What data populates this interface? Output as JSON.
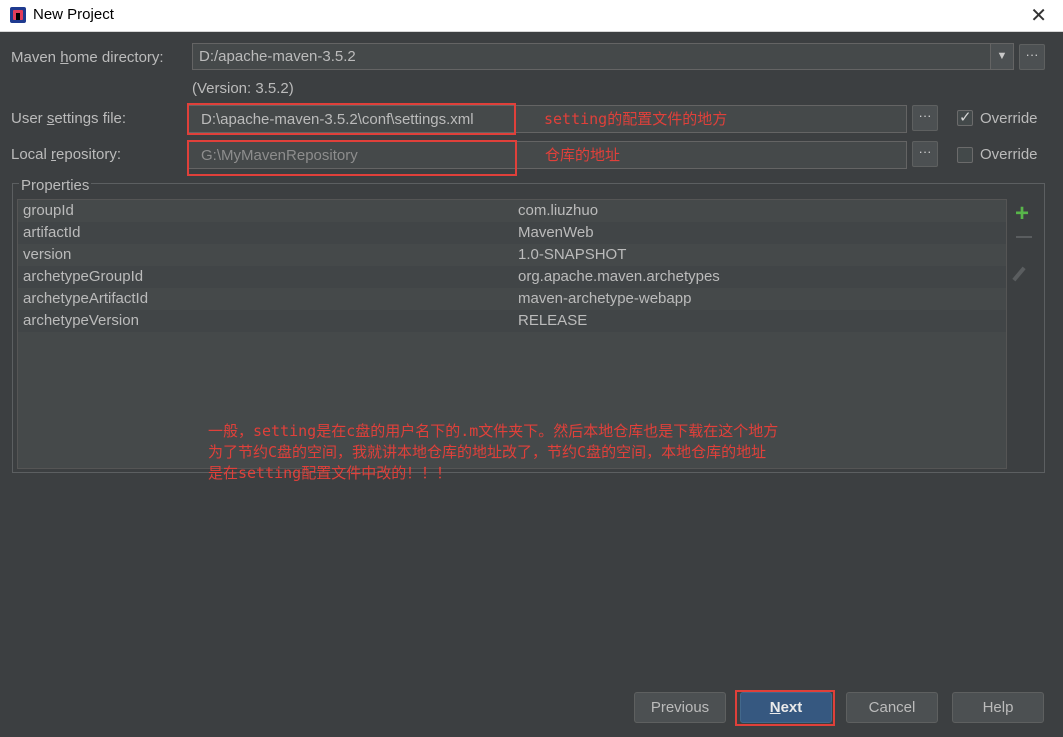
{
  "window": {
    "title": "New Project",
    "close_glyph": "✕"
  },
  "maven_home": {
    "label_pre": "Maven ",
    "label_u": "h",
    "label_post": "ome directory:",
    "value": "D:/apache-maven-3.5.2",
    "version_text": "(Version: 3.5.2)",
    "dropdown_glyph": "▼",
    "browse": "···"
  },
  "user_settings": {
    "label_pre": "User ",
    "label_u": "s",
    "label_post": "ettings file:",
    "value": "D:\\apache-maven-3.5.2\\conf\\settings.xml",
    "browse": "···",
    "override_label": "Override",
    "override_checked": true
  },
  "local_repo": {
    "label_pre": "Local ",
    "label_u": "r",
    "label_post": "epository:",
    "value": "G:\\MyMavenRepository",
    "browse": "···",
    "override_label": "Override",
    "override_checked": false
  },
  "properties": {
    "title": "Properties",
    "rows": [
      {
        "key": "groupId",
        "value": "com.liuzhuo"
      },
      {
        "key": "artifactId",
        "value": "MavenWeb"
      },
      {
        "key": "version",
        "value": "1.0-SNAPSHOT"
      },
      {
        "key": "archetypeGroupId",
        "value": "org.apache.maven.archetypes"
      },
      {
        "key": "archetypeArtifactId",
        "value": "maven-archetype-webapp"
      },
      {
        "key": "archetypeVersion",
        "value": "RELEASE"
      }
    ],
    "add_glyph": "+"
  },
  "annotations": {
    "settings_note": "setting的配置文件的地方",
    "repo_note": "仓库的地址",
    "line1": "一般，setting是在c盘的用户名下的.m文件夹下。然后本地仓库也是下载在这个地方",
    "line2": "为了节约C盘的空间，我就讲本地仓库的地址改了，节约C盘的空间，本地仓库的地址",
    "line3": "是在setting配置文件中改的！！！"
  },
  "buttons": {
    "previous": "Previous",
    "next_u": "N",
    "next_rest": "ext",
    "cancel": "Cancel",
    "help": "Help"
  },
  "colors": {
    "background": "#3c3f41",
    "annotation_red": "#e0403a",
    "default_button": "#365880",
    "add_green": "#58b54a"
  }
}
